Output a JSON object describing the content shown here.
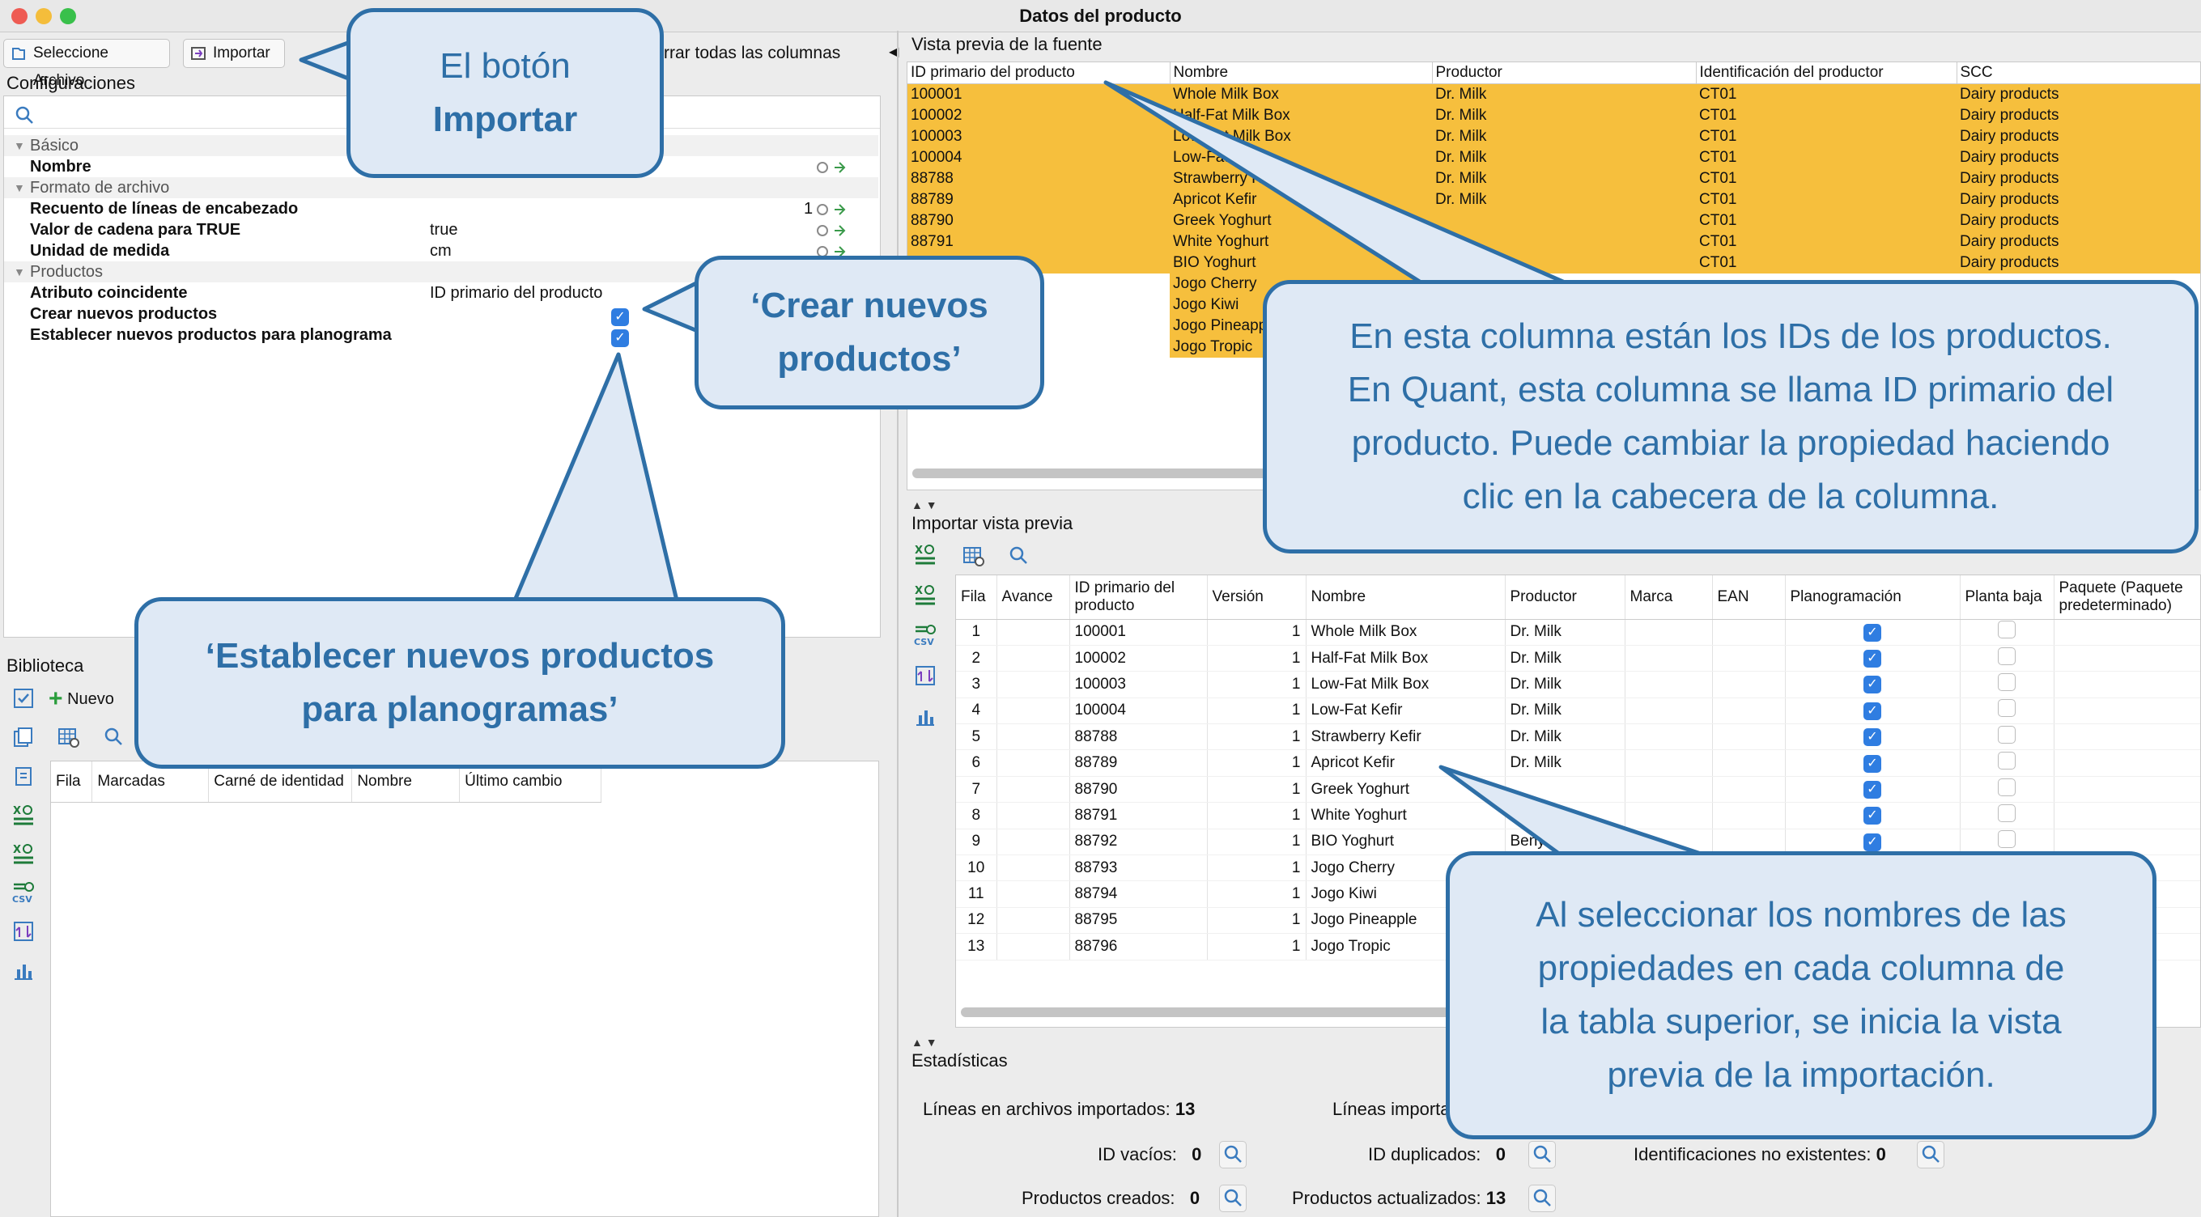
{
  "window": {
    "title": "Datos del producto"
  },
  "toolbar": {
    "select_file": "Seleccione Archivo",
    "import": "Importar",
    "clear_columns": "rrar todas las columnas"
  },
  "config": {
    "title": "Configuraciones",
    "groups": {
      "basic": "Básico",
      "file_format": "Formato de archivo",
      "products": "Productos"
    },
    "rows": {
      "name": "Nombre",
      "header_lines": "Recuento de líneas de encabezado",
      "header_lines_value": "1",
      "true_string": "Valor de cadena para TRUE",
      "true_string_value": "true",
      "unit": "Unidad de medida",
      "unit_value": "cm",
      "match_attr": "Atributo coincidente",
      "match_attr_value": "ID primario del producto",
      "create_new": "Crear nuevos productos",
      "set_planogram": "Establecer nuevos productos para planograma"
    }
  },
  "library": {
    "title": "Biblioteca",
    "new_button": "Nuevo",
    "columns": [
      "Fila",
      "Marcadas",
      "Carné de identidad",
      "Nombre",
      "Último cambio"
    ]
  },
  "source": {
    "title": "Vista previa de la fuente",
    "columns": [
      "ID primario del producto",
      "Nombre",
      "Productor",
      "Identificación del productor",
      "SCC"
    ],
    "rows": [
      [
        "100001",
        "Whole Milk Box",
        "Dr. Milk",
        "CT01",
        "Dairy products"
      ],
      [
        "100002",
        "Half-Fat Milk Box",
        "Dr. Milk",
        "CT01",
        "Dairy products"
      ],
      [
        "100003",
        "Low-Fat Milk Box",
        "Dr. Milk",
        "CT01",
        "Dairy products"
      ],
      [
        "100004",
        "Low-Fat Kefir",
        "Dr. Milk",
        "CT01",
        "Dairy products"
      ],
      [
        "88788",
        "Strawberry Kefir",
        "Dr. Milk",
        "CT01",
        "Dairy products"
      ],
      [
        "88789",
        "Apricot Kefir",
        "Dr. Milk",
        "CT01",
        "Dairy products"
      ],
      [
        "88790",
        "Greek Yoghurt",
        "",
        "CT01",
        "Dairy products"
      ],
      [
        "88791",
        "White Yoghurt",
        "",
        "CT01",
        "Dairy products"
      ],
      [
        "",
        "BIO Yoghurt",
        "",
        "CT01",
        "Dairy products"
      ],
      [
        "",
        "Jogo Cherry",
        "",
        "",
        ""
      ],
      [
        "",
        "Jogo Kiwi",
        "",
        "",
        ""
      ],
      [
        "",
        "Jogo Pineapple",
        "",
        "",
        ""
      ],
      [
        "",
        "Jogo Tropic",
        "",
        "",
        ""
      ]
    ]
  },
  "import_preview": {
    "title": "Importar vista previa",
    "columns": [
      "Fila",
      "Avance",
      "ID primario del producto",
      "Versión",
      "Nombre",
      "Productor",
      "Marca",
      "EAN",
      "Planogramación",
      "Planta baja",
      "Paquete (Paquete predeterminado)"
    ],
    "rows": [
      {
        "row": "1",
        "id": "100001",
        "version": "1",
        "name": "Whole Milk Box",
        "producer": "Dr. Milk",
        "plano": true
      },
      {
        "row": "2",
        "id": "100002",
        "version": "1",
        "name": "Half-Fat Milk Box",
        "producer": "Dr. Milk",
        "plano": true
      },
      {
        "row": "3",
        "id": "100003",
        "version": "1",
        "name": "Low-Fat Milk Box",
        "producer": "Dr. Milk",
        "plano": true
      },
      {
        "row": "4",
        "id": "100004",
        "version": "1",
        "name": "Low-Fat Kefir",
        "producer": "Dr. Milk",
        "plano": true
      },
      {
        "row": "5",
        "id": "88788",
        "version": "1",
        "name": "Strawberry Kefir",
        "producer": "Dr. Milk",
        "plano": true
      },
      {
        "row": "6",
        "id": "88789",
        "version": "1",
        "name": "Apricot Kefir",
        "producer": "Dr. Milk",
        "plano": true
      },
      {
        "row": "7",
        "id": "88790",
        "version": "1",
        "name": "Greek Yoghurt",
        "producer": "",
        "plano": true
      },
      {
        "row": "8",
        "id": "88791",
        "version": "1",
        "name": "White Yoghurt",
        "producer": "",
        "plano": true
      },
      {
        "row": "9",
        "id": "88792",
        "version": "1",
        "name": "BIO Yoghurt",
        "producer": "Beny",
        "plano": true
      },
      {
        "row": "10",
        "id": "88793",
        "version": "1",
        "name": "Jogo Cherry",
        "producer": "",
        "plano": false
      },
      {
        "row": "11",
        "id": "88794",
        "version": "1",
        "name": "Jogo Kiwi",
        "producer": "",
        "plano": false
      },
      {
        "row": "12",
        "id": "88795",
        "version": "1",
        "name": "Jogo Pineapple",
        "producer": "",
        "plano": false
      },
      {
        "row": "13",
        "id": "88796",
        "version": "1",
        "name": "Jogo Tropic",
        "producer": "",
        "plano": false
      }
    ]
  },
  "stats": {
    "title": "Estadísticas",
    "lines_in_files": "Líneas en archivos importados:",
    "lines_in_files_value": "13",
    "lines_imported": "Líneas importa",
    "empty_ids": "ID vacíos:",
    "empty_ids_value": "0",
    "dup_ids": "ID duplicados:",
    "dup_ids_value": "0",
    "nonexistent": "Identificaciones no existentes:",
    "nonexistent_value": "0",
    "created": "Productos creados:",
    "created_value": "0",
    "updated": "Productos actualizados:",
    "updated_value": "13"
  },
  "callouts": {
    "import_l1": "El botón",
    "import_l2": "Importar",
    "create_l1": "‘Crear nuevos",
    "create_l2": "productos’",
    "plan_l1": "‘Establecer nuevos productos",
    "plan_l2": "para planogramas’",
    "id_l1": "En esta columna están los IDs de los productos.",
    "id_l2": "En Quant, esta columna se llama ID primario del",
    "id_l3": "producto. Puede cambiar la propiedad haciendo",
    "id_l4": "clic en la cabecera de la columna.",
    "sel_l1": "Al seleccionar los nombres de las",
    "sel_l2": "propiedades en cada columna de",
    "sel_l3": "la tabla superior, se inicia la vista",
    "sel_l4": "previa de la importación."
  },
  "colors": {
    "highlight": "#f6bf3d",
    "callout_border": "#2e6fa7",
    "callout_fill": "#dfe9f5",
    "checkbox": "#2f7de1"
  }
}
